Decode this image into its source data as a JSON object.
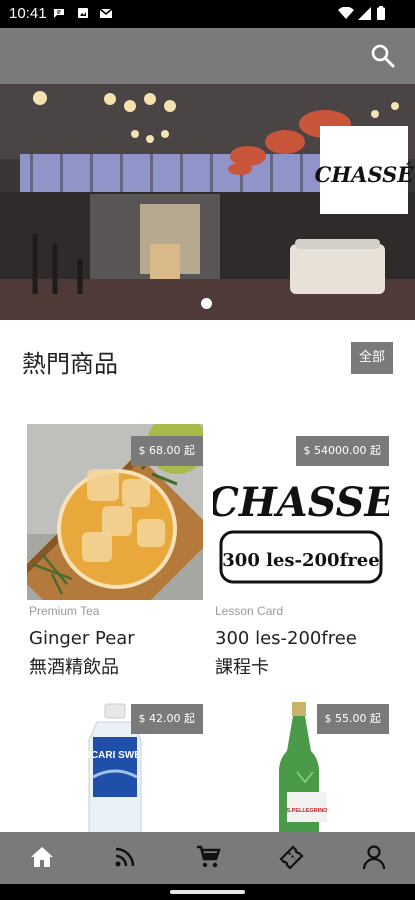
{
  "status_bar": {
    "time": "10:41"
  },
  "header": {
    "search_icon": "search-icon"
  },
  "banner": {
    "logo_text": "CHASSÉ",
    "active_slide": 1,
    "slide_count": 1
  },
  "section": {
    "title": "熱門商品",
    "all_label": "全部"
  },
  "products": [
    {
      "price": "$ 68.00 起",
      "category": "Premium Tea",
      "name_line1": "Ginger Pear",
      "name_line2": "無酒精飲品"
    },
    {
      "price": "$ 54000.00 起",
      "category": "Lesson Card",
      "name_line1": "300 les-200free",
      "name_line2": "課程卡",
      "image_logo": "CHASSE",
      "image_caption": "300 les-200free"
    },
    {
      "price": "$ 42.00 起",
      "category": "",
      "name_line1": "",
      "name_line2": "",
      "image_text": "POCARI SWEAT"
    },
    {
      "price": "$ 55.00 起",
      "category": "",
      "name_line1": "",
      "name_line2": "",
      "image_text": "S.PELLEGRINO"
    }
  ],
  "bottom_nav": [
    {
      "icon": "home-icon",
      "active": true
    },
    {
      "icon": "rss-icon",
      "active": false
    },
    {
      "icon": "cart-icon",
      "active": false
    },
    {
      "icon": "ticket-icon",
      "active": false
    },
    {
      "icon": "user-icon",
      "active": false
    }
  ],
  "colors": {
    "bar_gray": "#7a7a7a",
    "status_black": "#000000",
    "text_dark": "#222222",
    "text_muted": "#9a9a9a"
  }
}
